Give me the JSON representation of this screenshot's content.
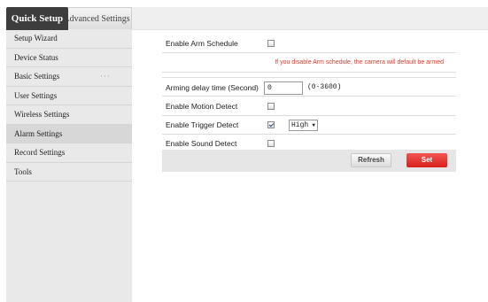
{
  "tabs": {
    "quick_setup": "Quick Setup",
    "advanced_settings": "Advanced Settings"
  },
  "sidebar": {
    "items": [
      {
        "label": "Setup Wizard"
      },
      {
        "label": "Device Status"
      },
      {
        "label": "Basic Settings",
        "more": "···"
      },
      {
        "label": "User Settings"
      },
      {
        "label": "Wireless Settings"
      },
      {
        "label": "Alarm Settings"
      },
      {
        "label": "Record Settings"
      },
      {
        "label": "Tools"
      }
    ],
    "active": "Alarm Settings"
  },
  "form": {
    "enable_arm_schedule": {
      "label": "Enable Arm Schedule",
      "checked": false
    },
    "warning": "If you disable Arm schedule, the camera will default be armed",
    "arming_delay": {
      "label": "Arming delay time (Second)",
      "value": "0",
      "range": "(0-3600)"
    },
    "enable_motion_detect": {
      "label": "Enable Motion Detect",
      "checked": false
    },
    "enable_trigger_detect": {
      "label": "Enable Trigger Detect",
      "checked": true,
      "level": "High"
    },
    "enable_sound_detect": {
      "label": "Enable Sound Detect",
      "checked": false
    }
  },
  "buttons": {
    "refresh": "Refresh",
    "set": "Set"
  },
  "colors": {
    "active_tab": "#3d3d3d",
    "sidebar_bg": "#e9e9e9",
    "warning_text": "#e0392b",
    "set_button": "#e0302c"
  }
}
